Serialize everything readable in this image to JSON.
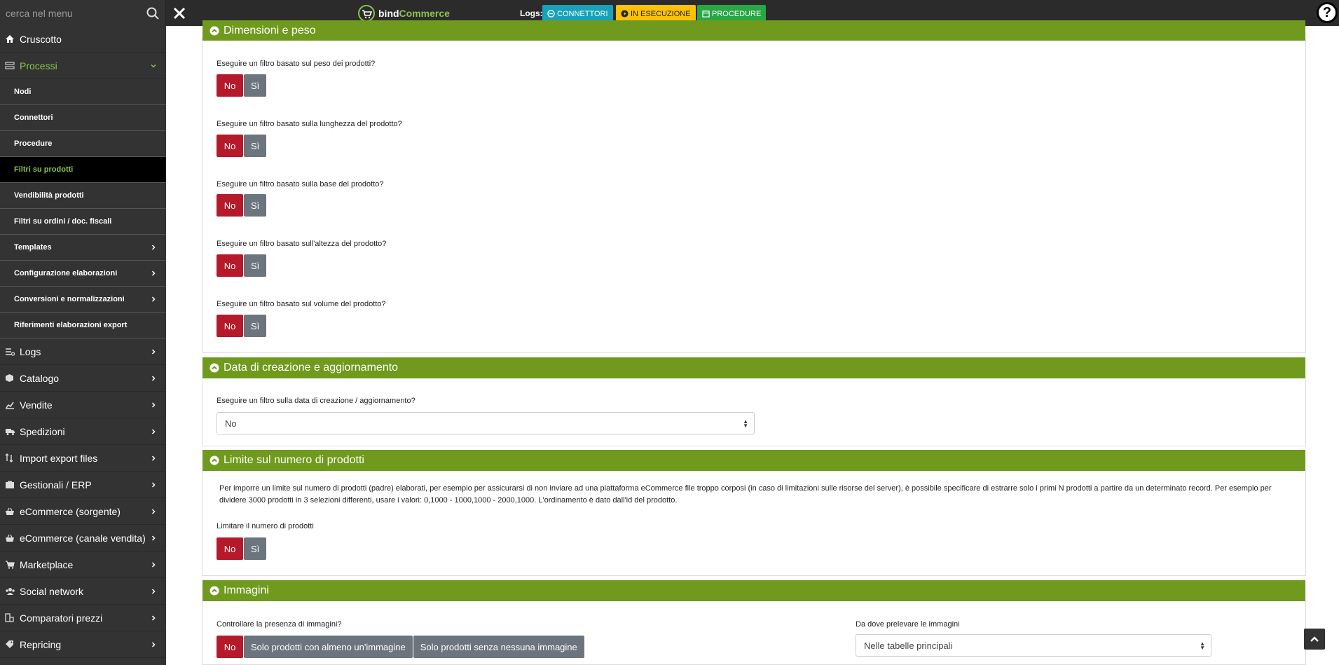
{
  "search": {
    "placeholder": "cerca nel menu"
  },
  "brand": {
    "part1": "bind",
    "part2": "Commerce"
  },
  "logs": {
    "label": "Logs:",
    "connettori": "CONNETTORI",
    "esecuzione": "IN ESECUZIONE",
    "procedure": "PROCEDURE"
  },
  "help": {
    "label": "?"
  },
  "sidebar": {
    "main_top": [
      {
        "label": "Cruscotto",
        "icon": "home-icon"
      },
      {
        "label": "Processi",
        "icon": "processes-icon"
      }
    ],
    "sub": [
      {
        "label": "Nodi"
      },
      {
        "label": "Connettori"
      },
      {
        "label": "Procedure"
      },
      {
        "label": "Filtri su prodotti"
      },
      {
        "label": "Vendibilità prodotti"
      },
      {
        "label": "Filtri su ordini / doc. fiscali"
      },
      {
        "label": "Templates"
      },
      {
        "label": "Configurazione elaborazioni"
      },
      {
        "label": "Conversioni e normalizzazioni"
      },
      {
        "label": "Riferimenti elaborazioni export"
      }
    ],
    "main": [
      {
        "label": "Logs",
        "icon": "logs-icon"
      },
      {
        "label": "Catalogo",
        "icon": "box-icon"
      },
      {
        "label": "Vendite",
        "icon": "chart-icon"
      },
      {
        "label": "Spedizioni",
        "icon": "truck-icon"
      },
      {
        "label": "Import export files",
        "icon": "transfer-icon"
      },
      {
        "label": "Gestionali / ERP",
        "icon": "building-icon"
      },
      {
        "label": "eCommerce (sorgente)",
        "icon": "basket-icon"
      },
      {
        "label": "eCommerce (canale vendita)",
        "icon": "basket-icon"
      },
      {
        "label": "Marketplace",
        "icon": "cart-icon"
      },
      {
        "label": "Social network",
        "icon": "users-icon"
      },
      {
        "label": "Comparatori prezzi",
        "icon": "compare-icon"
      },
      {
        "label": "Repricing",
        "icon": "tag-icon"
      }
    ]
  },
  "sections": {
    "dimensioni": {
      "title": "Dimensioni e peso",
      "questions": [
        "Eseguire un filtro basato sul peso dei prodotti?",
        "Eseguire un filtro basato sulla lunghezza del prodotto?",
        "Eseguire un filtro basato sulla base del prodotto?",
        "Eseguire un filtro basato sull'altezza del prodotto?",
        "Eseguire un filtro basato sul volume del prodotto?"
      ]
    },
    "data": {
      "title": "Data di creazione e aggiornamento",
      "question": "Eseguire un filtro sulla data di creazione / aggiornamento?",
      "select_value": "No"
    },
    "limite": {
      "title": "Limite sul numero di prodotti",
      "description": "Per imporre un limite sul numero di prodotti (padre) elaborati, per esempio per assicurarsi di non inviare ad una piattaforma eCommerce file troppo corposi (in caso di limitazioni sulle risorse del server), è possibile specificare di estrarre solo i primi N prodotti a partire da un determinato record. Per esempio per dividere 3000 prodotti in 3 selezioni differenti, usare i valori: 0,1000 - 1000,1000 - 2000,1000. L'ordinamento è dato dall'id del prodotto.",
      "question": "Limitare il numero di prodotti"
    },
    "immagini": {
      "title": "Immagini",
      "question": "Controllare la presenza di immagini?",
      "opt_no": "No",
      "opt_almeno": "Solo prodotti con almeno un'immagine",
      "opt_senza": "Solo prodotti senza nessuna immagine",
      "source_label": "Da dove prelevare le immagini",
      "source_value": "Nelle tabelle principali"
    }
  },
  "buttons": {
    "no": "No",
    "si": "Sì"
  }
}
